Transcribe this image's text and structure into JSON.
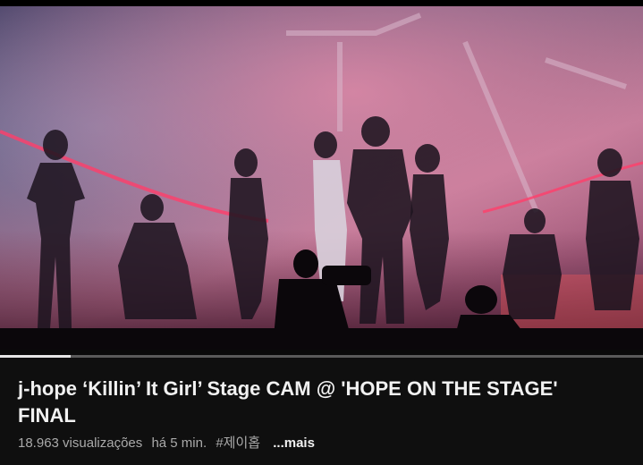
{
  "video": {
    "title": "j-hope ‘Killin’ It Girl’ Stage CAM @ 'HOPE ON THE STAGE' FINAL",
    "views": "18.963 visualizações",
    "time_ago": "há 5 min.",
    "hashtag": "#제이홉",
    "more_label": "...mais",
    "progress": 0.11
  },
  "colors": {
    "background": "#0f0f0f",
    "title_text": "#f1f1f1",
    "meta_text": "#aaaaaa",
    "progress_fill": "#e6e6e6",
    "progress_track": "#5a5a5a"
  }
}
